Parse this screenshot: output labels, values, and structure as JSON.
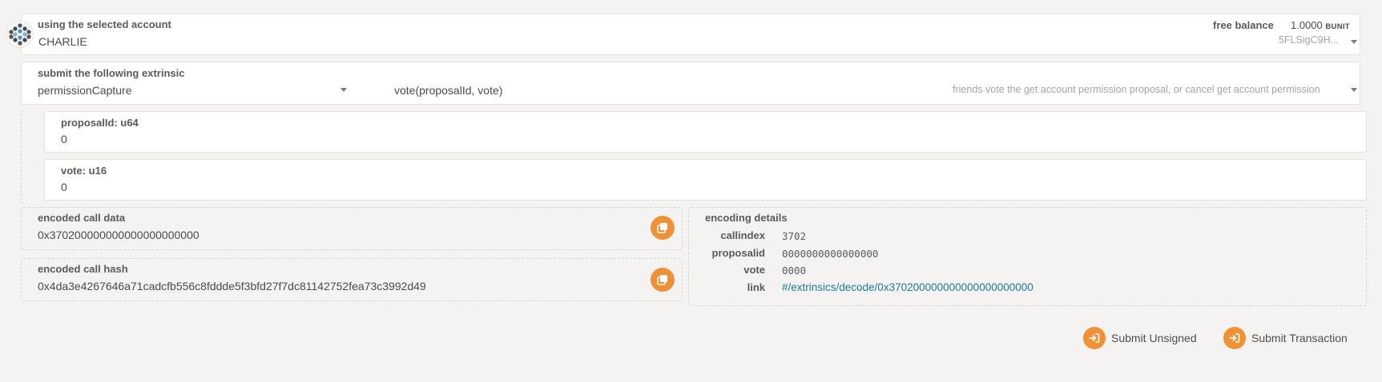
{
  "account": {
    "label": "using the selected account",
    "name": "CHARLIE",
    "balance_label": "free balance",
    "balance_value": "1.0000",
    "balance_unit": "BUNIT",
    "address_short": "5FLSigC9H..."
  },
  "extrinsic": {
    "label": "submit the following extrinsic",
    "section": "permissionCapture",
    "method": "vote(proposalId, vote)",
    "method_help": "friends vote the get account permission proposal, or cancel get account permission"
  },
  "params": [
    {
      "label": "proposalId: u64",
      "value": "0"
    },
    {
      "label": "vote: u16",
      "value": "0"
    }
  ],
  "encoded": {
    "call_data_label": "encoded call data",
    "call_data": "0x370200000000000000000000",
    "call_hash_label": "encoded call hash",
    "call_hash": "0x4da3e4267646a71cadcfb556c8fddde5f3bfd27f7dc81142752fea73c3992d49"
  },
  "details": {
    "title": "encoding details",
    "callindex_key": "callindex",
    "callindex_val": "3702",
    "proposalid_key": "proposalid",
    "proposalid_val": "0000000000000000",
    "vote_key": "vote",
    "vote_val": "0000",
    "link_key": "link",
    "link_val": "#/extrinsics/decode/0x370200000000000000000000"
  },
  "actions": {
    "unsigned": "Submit Unsigned",
    "transaction": "Submit Transaction"
  },
  "colors": {
    "accent": "#f19135",
    "link": "#1f7a97"
  }
}
